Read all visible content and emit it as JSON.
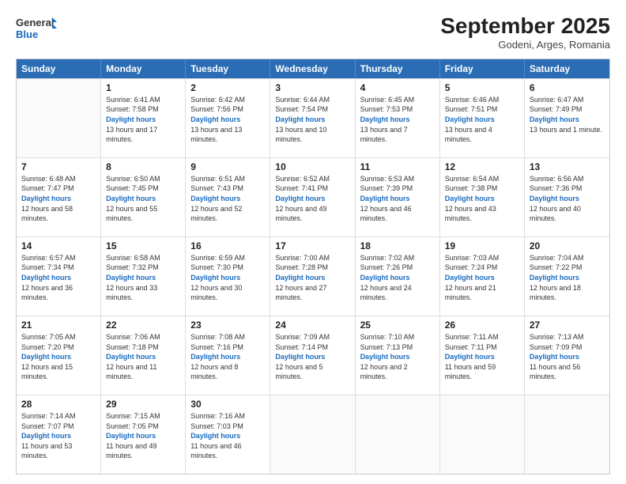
{
  "header": {
    "logo": {
      "line1": "General",
      "line2": "Blue"
    },
    "title": "September 2025",
    "subtitle": "Godeni, Arges, Romania"
  },
  "calendar": {
    "days_of_week": [
      "Sunday",
      "Monday",
      "Tuesday",
      "Wednesday",
      "Thursday",
      "Friday",
      "Saturday"
    ],
    "weeks": [
      [
        {
          "day": "",
          "sunrise": "",
          "sunset": "",
          "daylight": ""
        },
        {
          "day": "1",
          "sunrise": "Sunrise: 6:41 AM",
          "sunset": "Sunset: 7:58 PM",
          "daylight": "Daylight: 13 hours and 17 minutes."
        },
        {
          "day": "2",
          "sunrise": "Sunrise: 6:42 AM",
          "sunset": "Sunset: 7:56 PM",
          "daylight": "Daylight: 13 hours and 13 minutes."
        },
        {
          "day": "3",
          "sunrise": "Sunrise: 6:44 AM",
          "sunset": "Sunset: 7:54 PM",
          "daylight": "Daylight: 13 hours and 10 minutes."
        },
        {
          "day": "4",
          "sunrise": "Sunrise: 6:45 AM",
          "sunset": "Sunset: 7:53 PM",
          "daylight": "Daylight: 13 hours and 7 minutes."
        },
        {
          "day": "5",
          "sunrise": "Sunrise: 6:46 AM",
          "sunset": "Sunset: 7:51 PM",
          "daylight": "Daylight: 13 hours and 4 minutes."
        },
        {
          "day": "6",
          "sunrise": "Sunrise: 6:47 AM",
          "sunset": "Sunset: 7:49 PM",
          "daylight": "Daylight: 13 hours and 1 minute."
        }
      ],
      [
        {
          "day": "7",
          "sunrise": "Sunrise: 6:48 AM",
          "sunset": "Sunset: 7:47 PM",
          "daylight": "Daylight: 12 hours and 58 minutes."
        },
        {
          "day": "8",
          "sunrise": "Sunrise: 6:50 AM",
          "sunset": "Sunset: 7:45 PM",
          "daylight": "Daylight: 12 hours and 55 minutes."
        },
        {
          "day": "9",
          "sunrise": "Sunrise: 6:51 AM",
          "sunset": "Sunset: 7:43 PM",
          "daylight": "Daylight: 12 hours and 52 minutes."
        },
        {
          "day": "10",
          "sunrise": "Sunrise: 6:52 AM",
          "sunset": "Sunset: 7:41 PM",
          "daylight": "Daylight: 12 hours and 49 minutes."
        },
        {
          "day": "11",
          "sunrise": "Sunrise: 6:53 AM",
          "sunset": "Sunset: 7:39 PM",
          "daylight": "Daylight: 12 hours and 46 minutes."
        },
        {
          "day": "12",
          "sunrise": "Sunrise: 6:54 AM",
          "sunset": "Sunset: 7:38 PM",
          "daylight": "Daylight: 12 hours and 43 minutes."
        },
        {
          "day": "13",
          "sunrise": "Sunrise: 6:56 AM",
          "sunset": "Sunset: 7:36 PM",
          "daylight": "Daylight: 12 hours and 40 minutes."
        }
      ],
      [
        {
          "day": "14",
          "sunrise": "Sunrise: 6:57 AM",
          "sunset": "Sunset: 7:34 PM",
          "daylight": "Daylight: 12 hours and 36 minutes."
        },
        {
          "day": "15",
          "sunrise": "Sunrise: 6:58 AM",
          "sunset": "Sunset: 7:32 PM",
          "daylight": "Daylight: 12 hours and 33 minutes."
        },
        {
          "day": "16",
          "sunrise": "Sunrise: 6:59 AM",
          "sunset": "Sunset: 7:30 PM",
          "daylight": "Daylight: 12 hours and 30 minutes."
        },
        {
          "day": "17",
          "sunrise": "Sunrise: 7:00 AM",
          "sunset": "Sunset: 7:28 PM",
          "daylight": "Daylight: 12 hours and 27 minutes."
        },
        {
          "day": "18",
          "sunrise": "Sunrise: 7:02 AM",
          "sunset": "Sunset: 7:26 PM",
          "daylight": "Daylight: 12 hours and 24 minutes."
        },
        {
          "day": "19",
          "sunrise": "Sunrise: 7:03 AM",
          "sunset": "Sunset: 7:24 PM",
          "daylight": "Daylight: 12 hours and 21 minutes."
        },
        {
          "day": "20",
          "sunrise": "Sunrise: 7:04 AM",
          "sunset": "Sunset: 7:22 PM",
          "daylight": "Daylight: 12 hours and 18 minutes."
        }
      ],
      [
        {
          "day": "21",
          "sunrise": "Sunrise: 7:05 AM",
          "sunset": "Sunset: 7:20 PM",
          "daylight": "Daylight: 12 hours and 15 minutes."
        },
        {
          "day": "22",
          "sunrise": "Sunrise: 7:06 AM",
          "sunset": "Sunset: 7:18 PM",
          "daylight": "Daylight: 12 hours and 11 minutes."
        },
        {
          "day": "23",
          "sunrise": "Sunrise: 7:08 AM",
          "sunset": "Sunset: 7:16 PM",
          "daylight": "Daylight: 12 hours and 8 minutes."
        },
        {
          "day": "24",
          "sunrise": "Sunrise: 7:09 AM",
          "sunset": "Sunset: 7:14 PM",
          "daylight": "Daylight: 12 hours and 5 minutes."
        },
        {
          "day": "25",
          "sunrise": "Sunrise: 7:10 AM",
          "sunset": "Sunset: 7:13 PM",
          "daylight": "Daylight: 12 hours and 2 minutes."
        },
        {
          "day": "26",
          "sunrise": "Sunrise: 7:11 AM",
          "sunset": "Sunset: 7:11 PM",
          "daylight": "Daylight: 11 hours and 59 minutes."
        },
        {
          "day": "27",
          "sunrise": "Sunrise: 7:13 AM",
          "sunset": "Sunset: 7:09 PM",
          "daylight": "Daylight: 11 hours and 56 minutes."
        }
      ],
      [
        {
          "day": "28",
          "sunrise": "Sunrise: 7:14 AM",
          "sunset": "Sunset: 7:07 PM",
          "daylight": "Daylight: 11 hours and 53 minutes."
        },
        {
          "day": "29",
          "sunrise": "Sunrise: 7:15 AM",
          "sunset": "Sunset: 7:05 PM",
          "daylight": "Daylight: 11 hours and 49 minutes."
        },
        {
          "day": "30",
          "sunrise": "Sunrise: 7:16 AM",
          "sunset": "Sunset: 7:03 PM",
          "daylight": "Daylight: 11 hours and 46 minutes."
        },
        {
          "day": "",
          "sunrise": "",
          "sunset": "",
          "daylight": ""
        },
        {
          "day": "",
          "sunrise": "",
          "sunset": "",
          "daylight": ""
        },
        {
          "day": "",
          "sunrise": "",
          "sunset": "",
          "daylight": ""
        },
        {
          "day": "",
          "sunrise": "",
          "sunset": "",
          "daylight": ""
        }
      ]
    ]
  }
}
